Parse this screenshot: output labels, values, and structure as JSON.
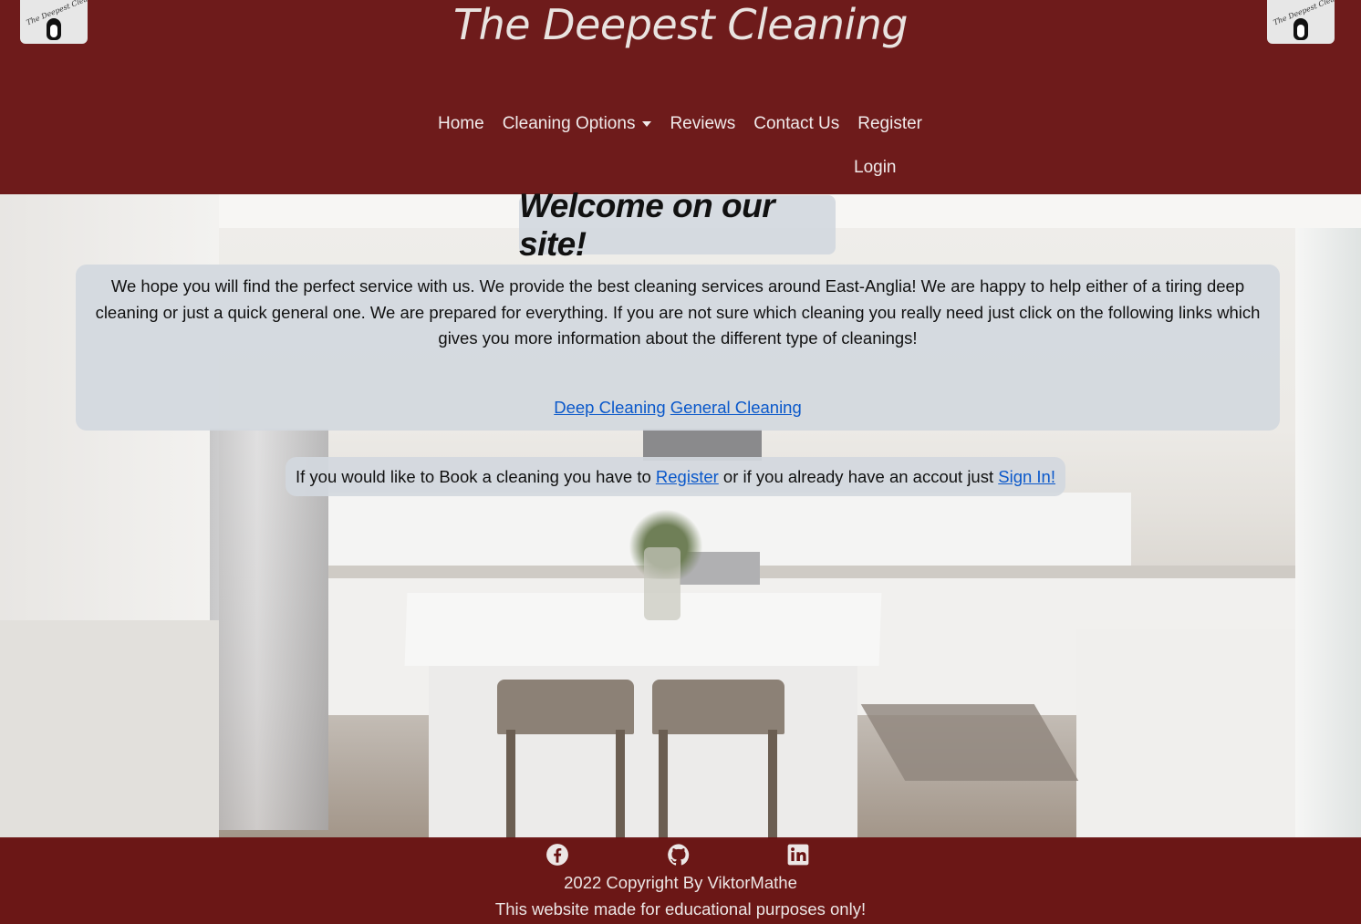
{
  "header": {
    "site_title": "The Deepest Cleaning",
    "logo_text": "The Deepest Cleaning",
    "nav": {
      "home": "Home",
      "cleaning_options": "Cleaning Options",
      "reviews": "Reviews",
      "contact": "Contact Us",
      "register": "Register",
      "login": "Login"
    }
  },
  "main": {
    "welcome": "Welcome on our site!",
    "intro": "We hope you will find the perfect service with us. We provide the best cleaning services around East-Anglia! We are happy to help either of a tiring deep cleaning or just a quick general one. We are prepared for everything. If you are not sure which cleaning you really need just click on the following links which gives you more information about the different type of cleanings!",
    "links": {
      "deep": "Deep Cleaning",
      "general": "General Cleaning"
    },
    "book": {
      "before": "If you would like to Book a cleaning you have to ",
      "register": "Register",
      "middle": " or if you already have an accout just ",
      "signin": "Sign In!"
    }
  },
  "footer": {
    "icons": [
      "facebook-icon",
      "github-icon",
      "linkedin-icon"
    ],
    "copyright": "2022 Copyright By ViktorMathe",
    "note": "This website made for educational purposes only!"
  },
  "colors": {
    "header_bg": "#681212",
    "panel_bg": "#d2d8de",
    "link": "#0a58ca"
  }
}
